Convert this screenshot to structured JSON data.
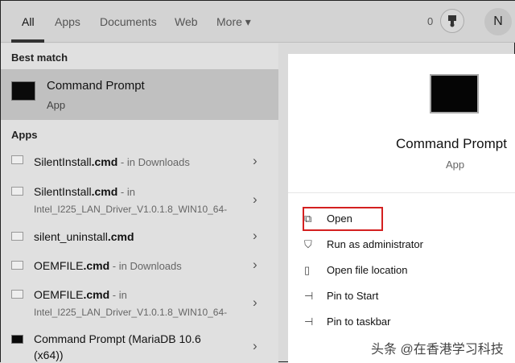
{
  "tabs": [
    "All",
    "Apps",
    "Documents",
    "Web",
    "More ▾"
  ],
  "header": {
    "badge_count": "0",
    "avatar_initial": "N"
  },
  "best_match": {
    "heading": "Best match",
    "title": "Command Prompt",
    "type": "App"
  },
  "apps": {
    "heading": "Apps",
    "items": [
      {
        "name": "SilentInstall",
        "ext": ".cmd",
        "loc": " - in Downloads",
        "loc2": ""
      },
      {
        "name": "SilentInstall",
        "ext": ".cmd",
        "loc": " - in",
        "loc2": "Intel_I225_LAN_Driver_V1.0.1.8_WIN10_64-"
      },
      {
        "name": "silent_uninstall",
        "ext": ".cmd",
        "loc": "",
        "loc2": ""
      },
      {
        "name": "OEMFILE",
        "ext": ".cmd",
        "loc": " - in Downloads",
        "loc2": ""
      },
      {
        "name": "OEMFILE",
        "ext": ".cmd",
        "loc": " - in",
        "loc2": "Intel_I225_LAN_Driver_V1.0.1.8_WIN10_64-"
      },
      {
        "name": "Command Prompt (MariaDB 10.6",
        "ext": "",
        "loc": "",
        "loc2": "(x64))"
      }
    ]
  },
  "detail": {
    "title": "Command Prompt",
    "type": "App",
    "actions": [
      "Open",
      "Run as administrator",
      "Open file location",
      "Pin to Start",
      "Pin to taskbar"
    ]
  },
  "watermark": "头条 @在香港学习科技",
  "colors": {
    "highlight": "#d42020"
  }
}
